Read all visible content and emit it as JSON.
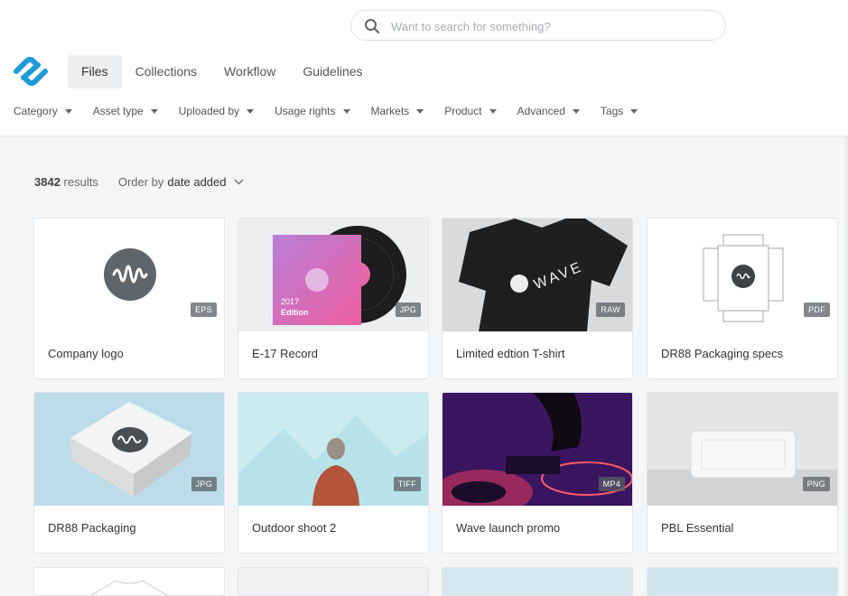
{
  "search": {
    "placeholder": "Want to search for something?"
  },
  "nav": {
    "tabs": [
      {
        "label": "Files"
      },
      {
        "label": "Collections"
      },
      {
        "label": "Workflow"
      },
      {
        "label": "Guidelines"
      }
    ]
  },
  "filters": [
    {
      "label": "Category"
    },
    {
      "label": "Asset type"
    },
    {
      "label": "Uploaded by"
    },
    {
      "label": "Usage rights"
    },
    {
      "label": "Markets"
    },
    {
      "label": "Product"
    },
    {
      "label": "Advanced"
    },
    {
      "label": "Tags"
    }
  ],
  "results": {
    "count": "3842",
    "count_suffix": "results",
    "order_prefix": "Order by",
    "order_value": "date added"
  },
  "assets": [
    {
      "name": "Company logo",
      "type": "EPS"
    },
    {
      "name": "E-17 Record",
      "type": "JPG",
      "cover_text_1": "2017",
      "cover_text_2": "Edition"
    },
    {
      "name": "Limited edtion T-shirt",
      "type": "RAW",
      "shirt_text": "WAVE"
    },
    {
      "name": "DR88 Packaging specs",
      "type": "PDF"
    },
    {
      "name": "DR88 Packaging",
      "type": "JPG"
    },
    {
      "name": "Outdoor shoot 2",
      "type": "TIFF"
    },
    {
      "name": "Wave launch promo",
      "type": "MP4"
    },
    {
      "name": "PBL Essential",
      "type": "PNG"
    }
  ],
  "colors": {
    "brand": "#1e9ad6",
    "badge": "#5a5f64",
    "text": "#333333"
  }
}
